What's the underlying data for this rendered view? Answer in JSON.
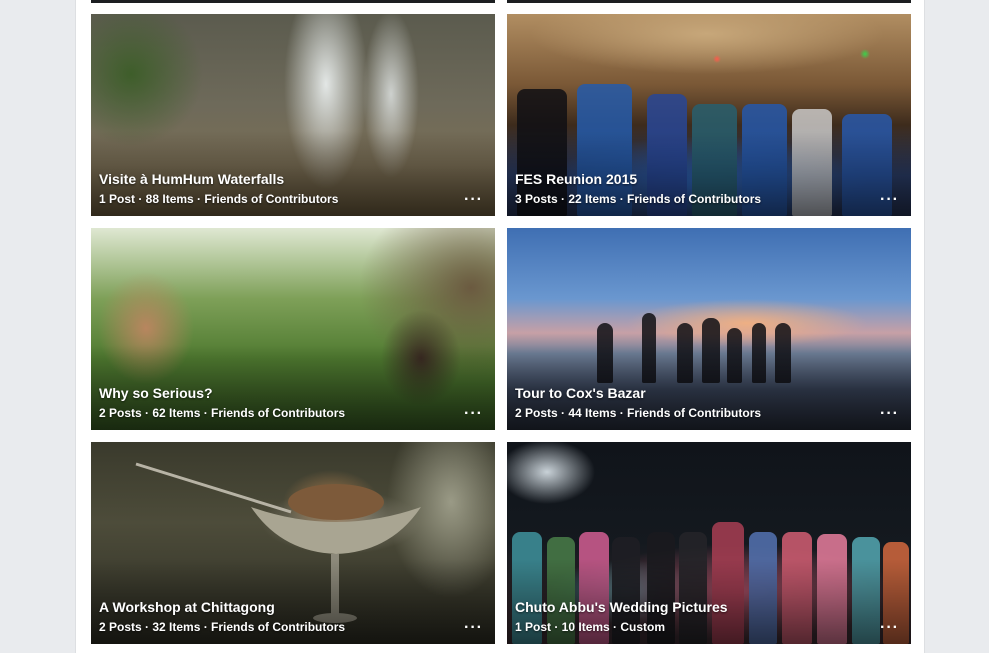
{
  "albums": [
    {
      "title": "Visite à HumHum Waterfalls",
      "meta": "1 Post · 88 Items · Friends of Contributors",
      "more": "···"
    },
    {
      "title": "FES Reunion 2015",
      "meta": "3 Posts · 22 Items · Friends of Contributors",
      "more": "···"
    },
    {
      "title": "Why so Serious?",
      "meta": "2 Posts · 62 Items · Friends of Contributors",
      "more": "···"
    },
    {
      "title": "Tour to Cox's Bazar",
      "meta": "2 Posts · 44 Items · Friends of Contributors",
      "more": "···"
    },
    {
      "title": "A Workshop at Chittagong",
      "meta": "2 Posts · 32 Items · Friends of Contributors",
      "more": "···"
    },
    {
      "title": "Chuto Abbu's Wedding Pictures",
      "meta": "1 Post · 10 Items · Custom",
      "more": "···"
    }
  ],
  "colors": {
    "page_background": "#e9ebee",
    "panel_background": "#ffffff",
    "overlay_text": "#ffffff"
  },
  "icons": {
    "more": "more-options-icon"
  }
}
